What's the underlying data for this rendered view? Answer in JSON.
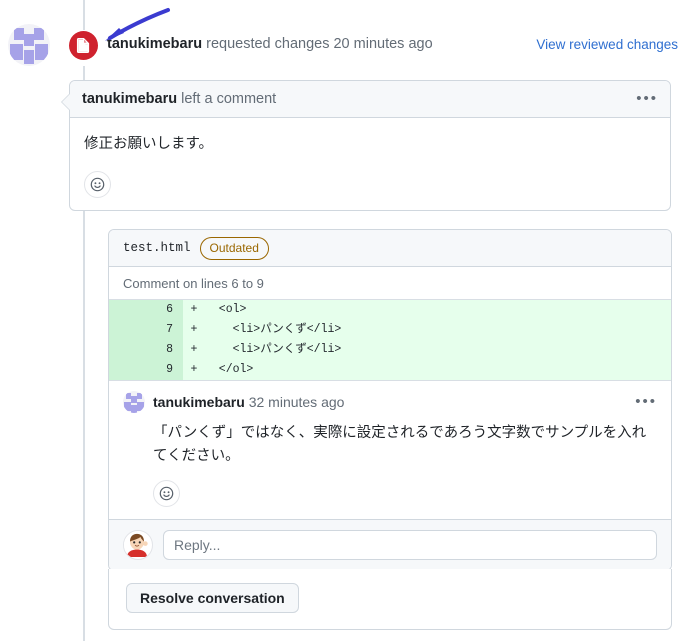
{
  "timeline": {
    "review": {
      "author": "tanukimebaru",
      "action_text": " requested changes 20 minutes ago",
      "badge_icon": "file-diff-icon",
      "badge_color": "#cf222e",
      "view_changes_link": "View reviewed changes",
      "link_color": "#2f6fd0"
    },
    "annotation": {
      "arrow_icon": "blue-arrow-icon",
      "arrow_color": "#3b3bd0"
    }
  },
  "comment_card": {
    "author": "tanukimebaru",
    "action_text": " left a comment",
    "menu_icon": "kebab-menu-icon",
    "body": "修正お願いします。",
    "reaction_icon": "smiley-reaction-icon"
  },
  "file_thread": {
    "file_name": "test.html",
    "status_badge": "Outdated",
    "status_badge_color": "#9a6700",
    "lines_note": "Comment on lines 6 to 9",
    "diff": {
      "rows": [
        {
          "number": "6",
          "sign": "+",
          "code": "  <ol>"
        },
        {
          "number": "7",
          "sign": "+",
          "code": "    <li>パンくず</li>"
        },
        {
          "number": "8",
          "sign": "+",
          "code": "    <li>パンくず</li>"
        },
        {
          "number": "9",
          "sign": "+",
          "code": "  </ol>"
        }
      ],
      "added_bg": "#e6ffec",
      "gutter_bg": "#ccf3d6"
    },
    "inline_comment": {
      "author": "tanukimebaru",
      "timestamp": "32 minutes ago",
      "menu_icon": "kebab-menu-icon",
      "body": "「パンくず」ではなく、実際に設定されるであろう文字数でサンプルを入れてください。",
      "reaction_icon": "smiley-reaction-icon"
    },
    "reply": {
      "avatar_icon": "user-avatar-icon",
      "placeholder": "Reply..."
    },
    "resolve_button": "Resolve conversation"
  }
}
